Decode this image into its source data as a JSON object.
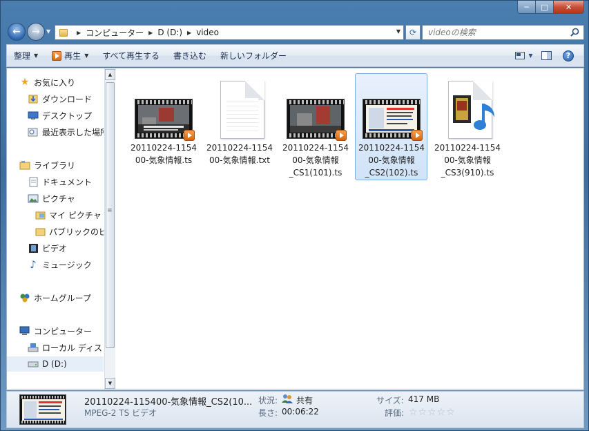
{
  "window": {
    "caption_min": "─",
    "caption_max": "□",
    "caption_close": "✕"
  },
  "address": {
    "crumbs": [
      "コンピューター",
      "D (D:)",
      "video"
    ]
  },
  "search": {
    "placeholder": "videoの検索"
  },
  "toolbar": {
    "organize": "整理",
    "play": "再生",
    "play_all": "すべて再生する",
    "burn": "書き込む",
    "new_folder": "新しいフォルダー"
  },
  "nav": {
    "favorites": "お気に入り",
    "downloads": "ダウンロード",
    "desktop": "デスクトップ",
    "recent": "最近表示した場所",
    "libraries": "ライブラリ",
    "documents": "ドキュメント",
    "pictures": "ピクチャ",
    "my_pictures": "マイ ピクチャ",
    "public_pictures": "パブリックのピ",
    "videos": "ビデオ",
    "music": "ミュージック",
    "homegroup": "ホームグループ",
    "computer": "コンピューター",
    "local_disk": "ローカル ディス",
    "drive_d": "D (D:)"
  },
  "files": [
    {
      "line1": "20110224-1154",
      "line2": "00-気象情報.ts",
      "line3": "",
      "kind": "video"
    },
    {
      "line1": "20110224-1154",
      "line2": "00-気象情報.txt",
      "line3": "",
      "kind": "text"
    },
    {
      "line1": "20110224-1154",
      "line2": "00-気象情報",
      "line3": "_CS1(101).ts",
      "kind": "video"
    },
    {
      "line1": "20110224-1154",
      "line2": "00-気象情報",
      "line3": "_CS2(102).ts",
      "kind": "video",
      "selected": true
    },
    {
      "line1": "20110224-1154",
      "line2": "00-気象情報",
      "line3": "_CS3(910).ts",
      "kind": "audio"
    }
  ],
  "details": {
    "name": "20110224-115400-気象情報_CS2(10...",
    "type": "MPEG-2 TS ビデオ",
    "status_label": "状況:",
    "status_value": "共有",
    "length_label": "長さ:",
    "length_value": "00:06:22",
    "size_label": "サイズ:",
    "size_value": "417 MB",
    "rating_label": "評価:",
    "rating_stars": "☆☆☆☆☆"
  }
}
